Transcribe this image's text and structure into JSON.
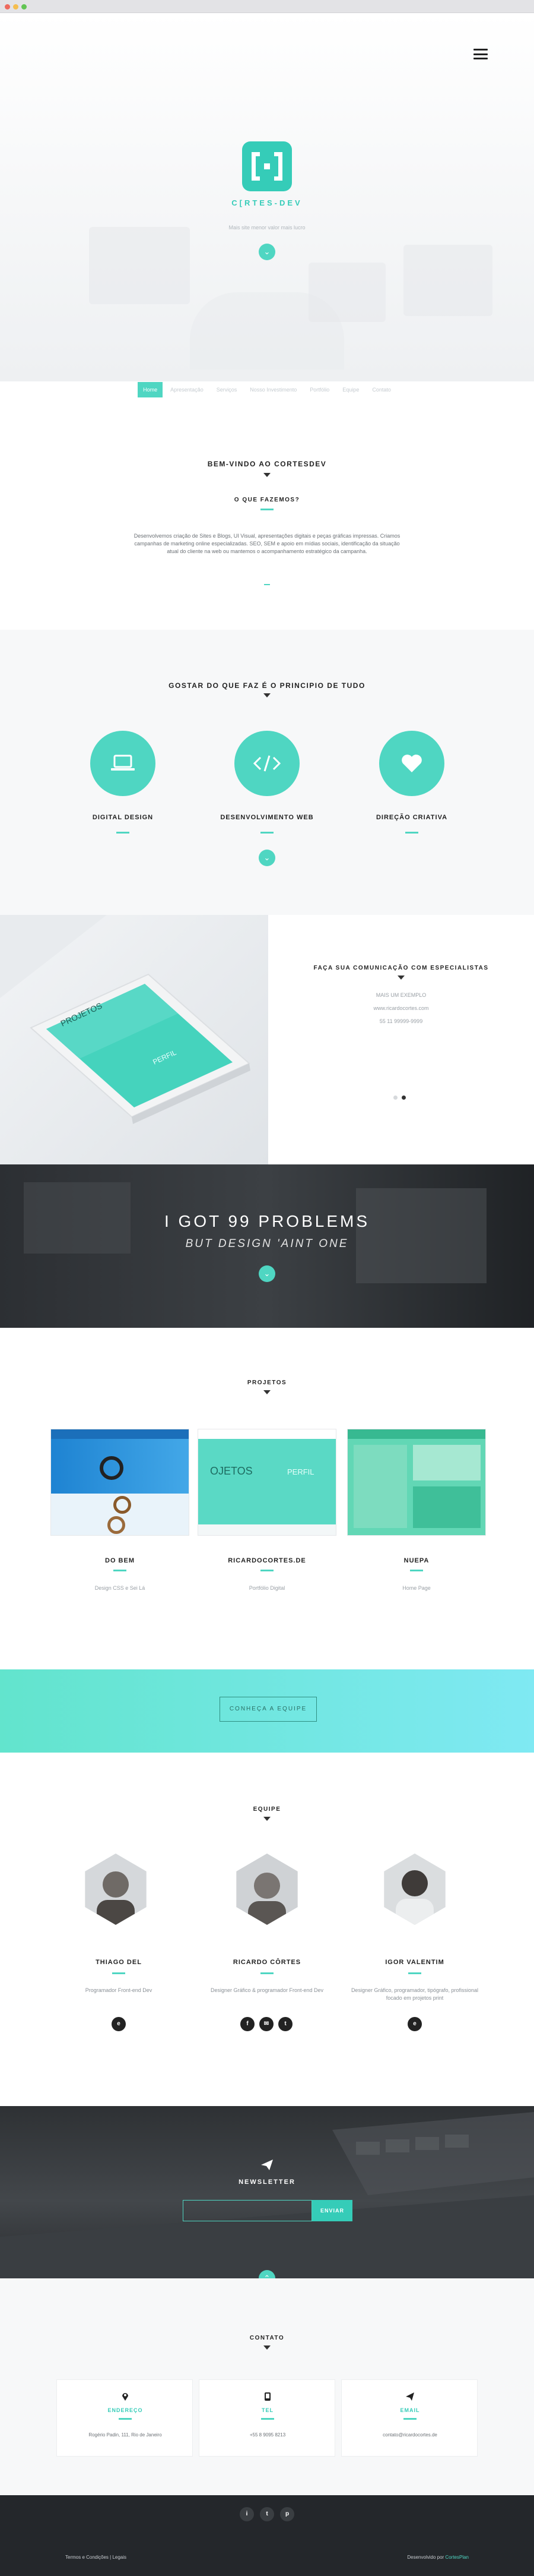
{
  "colors": {
    "accent": "#4fd6c2",
    "accent_dark": "#35ccb8",
    "dark": "#2c2f33",
    "footer": "#24272b"
  },
  "browser": {
    "dots": [
      "#ee6a5e",
      "#f5be4f",
      "#62c554"
    ]
  },
  "hero": {
    "brand": "C[RTES-DEV",
    "tagline": "Mais site menor valor mais lucro",
    "down_icon": "chevron-down-icon",
    "menu_icon": "hamburger-menu-icon"
  },
  "nav": {
    "items": [
      {
        "label": "Home",
        "active": true
      },
      {
        "label": "Apresentação",
        "active": false
      },
      {
        "label": "Serviços",
        "active": false
      },
      {
        "label": "Nosso Investimento",
        "active": false
      },
      {
        "label": "Portfólio",
        "active": false
      },
      {
        "label": "Equipe",
        "active": false
      },
      {
        "label": "Contato",
        "active": false
      }
    ]
  },
  "welcome": {
    "title": "BEM-VINDO AO CORTESDEV",
    "subtitle": "O QUE FAZEMOS?",
    "text": "Desenvolvemos criação de Sites e Blogs, UI Visual, apresentações digitais e peças gráficas impressas. Criamos campanhas de marketing online especializadas. SEO, SEM e apoio em mídias sociais, identificação da situação atual do cliente na web ou mantemos o acompanhamento estratégico da campanha."
  },
  "services": {
    "title": "GOSTAR DO QUE FAZ É O PRINCIPIO DE TUDO",
    "items": [
      {
        "label": "DIGITAL DESIGN",
        "icon": "laptop-icon"
      },
      {
        "label": "DESENVOLVIMENTO WEB",
        "icon": "code-icon"
      },
      {
        "label": "DIREÇÃO CRIATIVA",
        "icon": "heart-icon"
      }
    ]
  },
  "specialists": {
    "title": "FAÇA SUA COMUNICAÇÃO COM ESPECIALISTAS",
    "links": [
      "MAIS UM EXEMPLO",
      "www.ricardocortes.com",
      "55 11 99999-9999"
    ],
    "phone_texts": [
      "PROJETOS",
      "PERFIL"
    ],
    "active_page": 1
  },
  "problems": {
    "title": "I GOT 99 PROBLEMS",
    "subtitle": "BUT DESIGN 'AINT ONE"
  },
  "projects": {
    "title": "PROJETOS",
    "items": [
      {
        "name": "DO BEM",
        "sub": "Design CSS e Sei Lá"
      },
      {
        "name": "RICARDOCORTES.DE",
        "sub": "Portfólio Digital"
      },
      {
        "name": "NUEPA",
        "sub": "Home Page"
      }
    ],
    "thumb_texts": [
      "OJETOS",
      "PERFIL"
    ]
  },
  "team_cta": {
    "button": "CONHEÇA A EQUIPE"
  },
  "team": {
    "title": "EQUIPE",
    "members": [
      {
        "name": "THIAGO DEL",
        "role": "Programador Front-end Dev",
        "social": [
          "e"
        ]
      },
      {
        "name": "RICARDO CÔRTES",
        "role": "Designer Gráfico & programador Front-end Dev",
        "social": [
          "f",
          "✉",
          "t"
        ]
      },
      {
        "name": "IGOR VALENTIM",
        "role": "Designer Gráfico, programador, tipógrafo, profissional focado em projetos print",
        "social": [
          "e"
        ]
      }
    ]
  },
  "newsletter": {
    "title": "NEWSLETTER",
    "placeholder": "",
    "button": "ENVIAR"
  },
  "contact": {
    "title": "CONTATO",
    "cards": [
      {
        "title": "ENDEREÇO",
        "text": "Rogério Padin, 111, Rio de Janeiro",
        "icon": "map-pin-icon"
      },
      {
        "title": "TEL",
        "text": "+55 8 9095 8213",
        "icon": "phone-icon"
      },
      {
        "title": "EMAIL",
        "text": "contato@ricardocortes.de",
        "icon": "send-icon"
      }
    ],
    "social": [
      "i",
      "t",
      "p"
    ]
  },
  "footer": {
    "left": "Termos e Condições | Legais",
    "right_prefix": "Desenvolvido por",
    "right_name": "CortesPlan"
  }
}
